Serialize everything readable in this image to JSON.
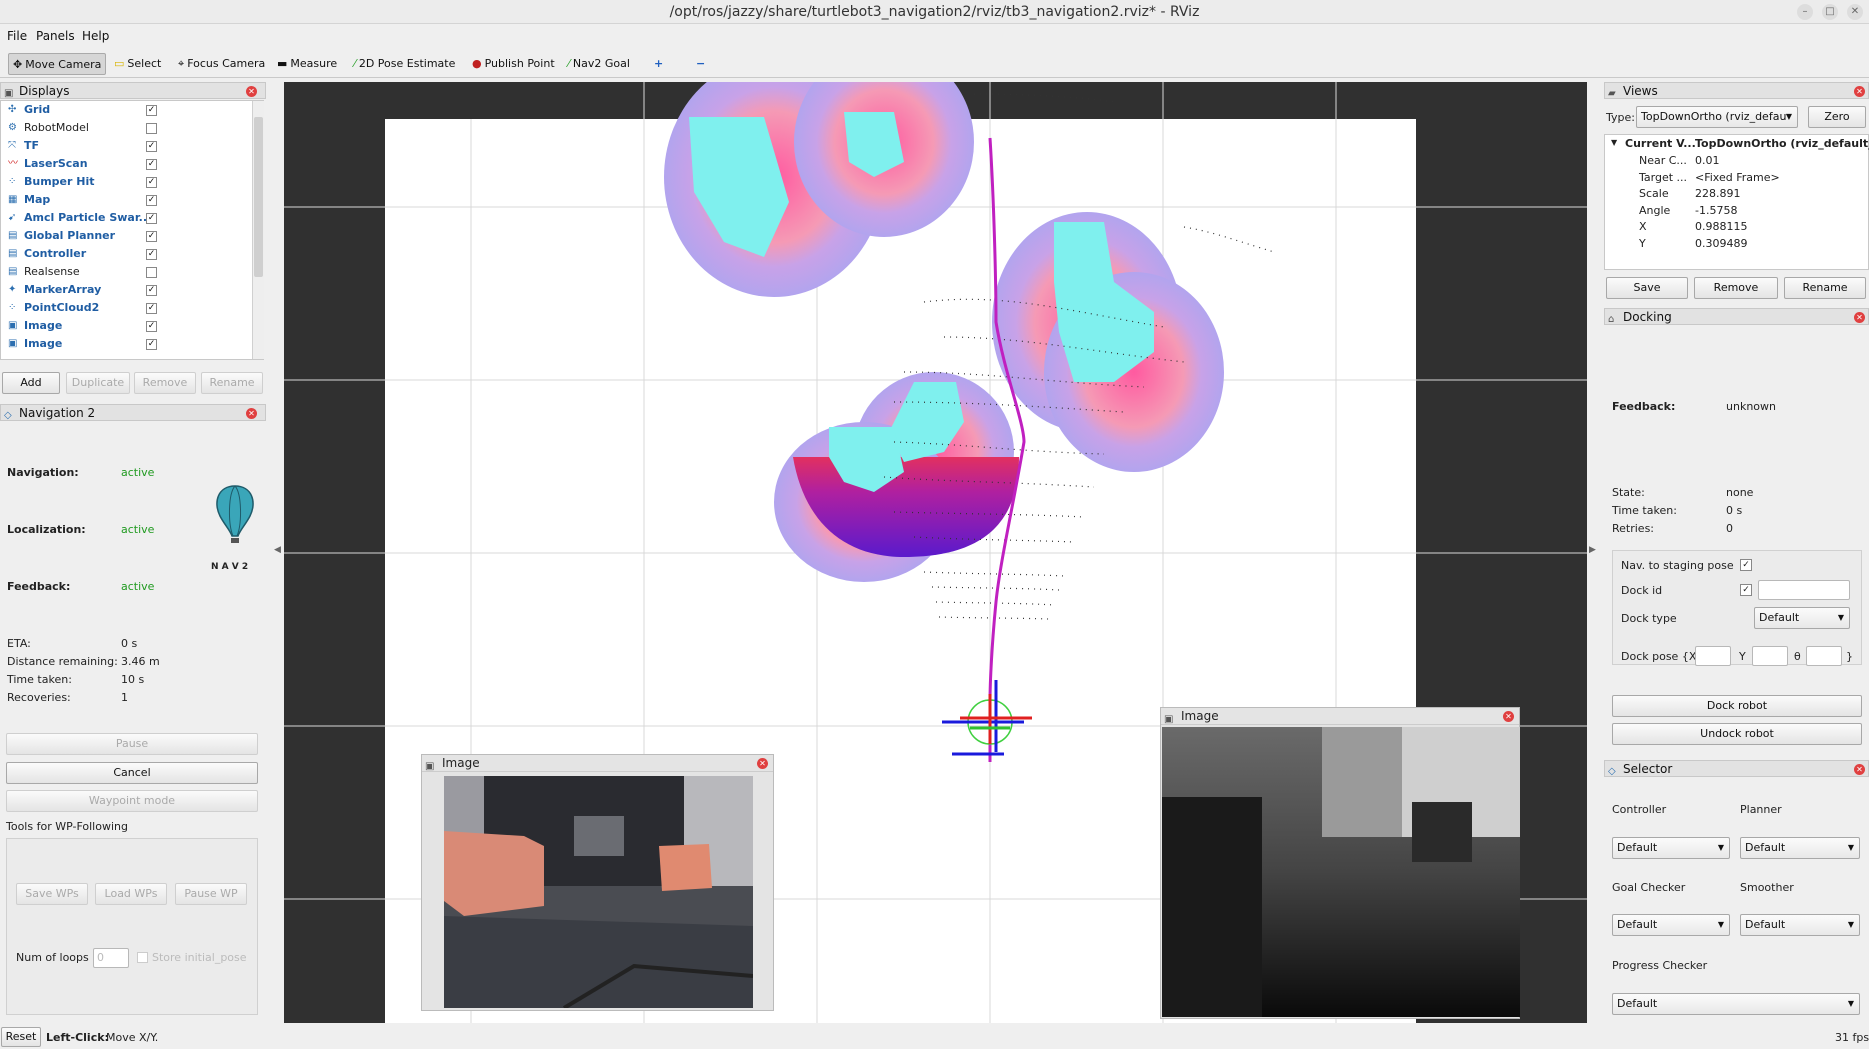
{
  "window": {
    "title": "/opt/ros/jazzy/share/turtlebot3_navigation2/rviz/tb3_navigation2.rviz* - RViz"
  },
  "menu": [
    "File",
    "Panels",
    "Help"
  ],
  "toolbar": {
    "move_camera": "Move Camera",
    "select": "Select",
    "focus_camera": "Focus Camera",
    "measure": "Measure",
    "pose_estimate": "2D Pose Estimate",
    "publish_point": "Publish Point",
    "nav2_goal": "Nav2 Goal",
    "plus": "+",
    "minus": "−"
  },
  "displays": {
    "title": "Displays",
    "items": [
      {
        "label": "Grid",
        "checked": true,
        "icon": "grid-icon"
      },
      {
        "label": "RobotModel",
        "checked": false,
        "icon": "robot-icon"
      },
      {
        "label": "TF",
        "checked": true,
        "icon": "tf-icon"
      },
      {
        "label": "LaserScan",
        "checked": true,
        "icon": "laser-icon"
      },
      {
        "label": "Bumper Hit",
        "checked": true,
        "icon": "points-icon"
      },
      {
        "label": "Map",
        "checked": true,
        "icon": "map-icon"
      },
      {
        "label": "Amcl Particle Swar...",
        "checked": true,
        "icon": "particle-icon"
      },
      {
        "label": "Global Planner",
        "checked": true,
        "icon": "folder-icon"
      },
      {
        "label": "Controller",
        "checked": true,
        "icon": "folder-icon"
      },
      {
        "label": "Realsense",
        "checked": false,
        "icon": "folder-icon"
      },
      {
        "label": "MarkerArray",
        "checked": true,
        "icon": "marker-icon"
      },
      {
        "label": "PointCloud2",
        "checked": true,
        "icon": "points-icon"
      },
      {
        "label": "Image",
        "checked": true,
        "icon": "image-icon"
      },
      {
        "label": "Image",
        "checked": true,
        "icon": "image-icon"
      }
    ],
    "buttons": {
      "add": "Add",
      "duplicate": "Duplicate",
      "remove": "Remove",
      "rename": "Rename"
    }
  },
  "nav2": {
    "title": "Navigation 2",
    "navigation_label": "Navigation:",
    "navigation_value": "active",
    "localization_label": "Localization:",
    "localization_value": "active",
    "feedback_label": "Feedback:",
    "feedback_value": "active",
    "logo_text": "N A V 2",
    "eta_label": "ETA:",
    "eta_value": "0 s",
    "distance_label": "Distance remaining:",
    "distance_value": "3.46 m",
    "time_label": "Time taken:",
    "time_value": "10 s",
    "recoveries_label": "Recoveries:",
    "recoveries_value": "1",
    "pause": "Pause",
    "cancel": "Cancel",
    "waypoint_mode": "Waypoint mode",
    "wp_tools_label": "Tools for WP-Following",
    "save_wps": "Save WPs",
    "load_wps": "Load WPs",
    "pause_wp": "Pause WP",
    "loops_label": "Num of loops",
    "loops_value": "0",
    "store_initial_pose": "Store initial_pose"
  },
  "views": {
    "title": "Views",
    "type_label": "Type:",
    "type_value": "TopDownOrtho (rviz_defau",
    "zero": "Zero",
    "current_label": "Current V...",
    "current_value": "TopDownOrtho (rviz_default_...",
    "props": [
      {
        "k": "Near C...",
        "v": "0.01"
      },
      {
        "k": "Target ...",
        "v": "<Fixed Frame>"
      },
      {
        "k": "Scale",
        "v": "228.891"
      },
      {
        "k": "Angle",
        "v": "-1.5758"
      },
      {
        "k": "X",
        "v": "0.988115"
      },
      {
        "k": "Y",
        "v": "0.309489"
      }
    ],
    "save": "Save",
    "remove": "Remove",
    "rename": "Rename"
  },
  "docking": {
    "title": "Docking",
    "feedback_label": "Feedback:",
    "feedback_value": "unknown",
    "state_label": "State:",
    "state_value": "none",
    "time_label": "Time taken:",
    "time_value": "0 s",
    "retries_label": "Retries:",
    "retries_value": "0",
    "staging_label": "Nav. to staging pose",
    "dock_id_label": "Dock id",
    "dock_type_label": "Dock type",
    "dock_type_value": "Default",
    "dock_pose_label": "Dock pose {X",
    "y_label": "Y",
    "theta_label": "θ",
    "close_brace": "}",
    "dock_robot": "Dock robot",
    "undock_robot": "Undock robot"
  },
  "selector": {
    "title": "Selector",
    "controller_label": "Controller",
    "planner_label": "Planner",
    "controller_value": "Default",
    "planner_value": "Default",
    "goal_checker_label": "Goal Checker",
    "smoother_label": "Smoother",
    "goal_checker_value": "Default",
    "smoother_value": "Default",
    "progress_checker_label": "Progress Checker",
    "progress_checker_value": "Default"
  },
  "image_windows": {
    "left_title": "Image",
    "right_title": "Image"
  },
  "status": {
    "reset": "Reset",
    "hint_bold": "Left-Click:",
    "hint": "Move X/Y.",
    "fps": "31 fps"
  }
}
